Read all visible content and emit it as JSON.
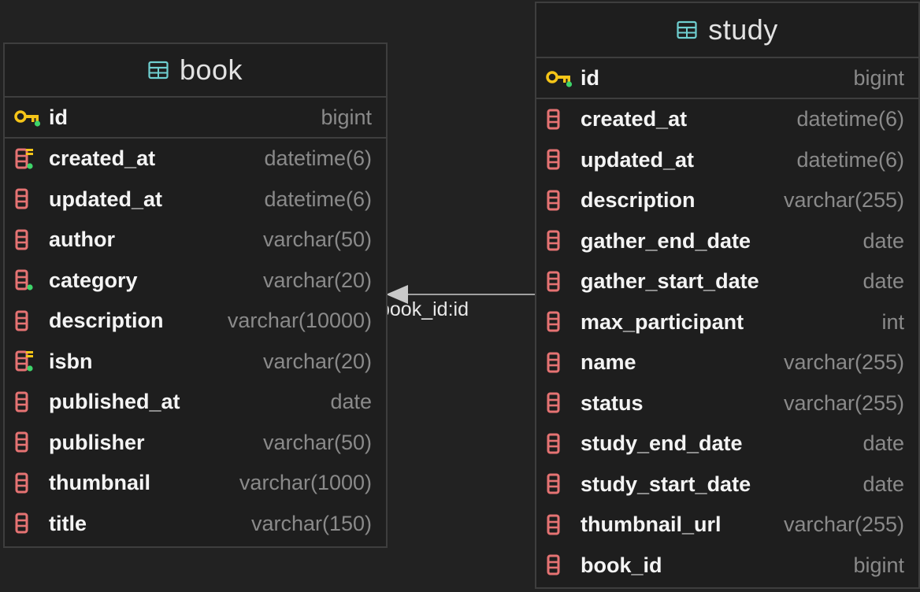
{
  "colors": {
    "background": "#222222",
    "table_border": "#3e3e3e",
    "column_icon": "#e57373",
    "key_icon": "#f5c518",
    "table_icon": "#6fcfd0",
    "indicator_green": "#3ed46a",
    "relation_line": "#a0a0a0"
  },
  "tables": {
    "book": {
      "title": "book",
      "icon": "table-icon",
      "primary_key": {
        "name": "id",
        "type": "bigint",
        "icon": "key-icon"
      },
      "columns": [
        {
          "name": "created_at",
          "type": "datetime(6)",
          "icon": "index-column-icon"
        },
        {
          "name": "updated_at",
          "type": "datetime(6)",
          "icon": "column-icon"
        },
        {
          "name": "author",
          "type": "varchar(50)",
          "icon": "column-icon"
        },
        {
          "name": "category",
          "type": "varchar(20)",
          "icon": "not-null-column-icon"
        },
        {
          "name": "description",
          "type": "varchar(10000)",
          "icon": "column-icon"
        },
        {
          "name": "isbn",
          "type": "varchar(20)",
          "icon": "index-column-icon"
        },
        {
          "name": "published_at",
          "type": "date",
          "icon": "column-icon"
        },
        {
          "name": "publisher",
          "type": "varchar(50)",
          "icon": "column-icon"
        },
        {
          "name": "thumbnail",
          "type": "varchar(1000)",
          "icon": "column-icon"
        },
        {
          "name": "title",
          "type": "varchar(150)",
          "icon": "column-icon"
        }
      ]
    },
    "study": {
      "title": "study",
      "icon": "table-icon",
      "primary_key": {
        "name": "id",
        "type": "bigint",
        "icon": "key-icon"
      },
      "columns": [
        {
          "name": "created_at",
          "type": "datetime(6)",
          "icon": "column-icon"
        },
        {
          "name": "updated_at",
          "type": "datetime(6)",
          "icon": "column-icon"
        },
        {
          "name": "description",
          "type": "varchar(255)",
          "icon": "column-icon"
        },
        {
          "name": "gather_end_date",
          "type": "date",
          "icon": "column-icon"
        },
        {
          "name": "gather_start_date",
          "type": "date",
          "icon": "column-icon"
        },
        {
          "name": "max_participant",
          "type": "int",
          "icon": "column-icon"
        },
        {
          "name": "name",
          "type": "varchar(255)",
          "icon": "column-icon"
        },
        {
          "name": "status",
          "type": "varchar(255)",
          "icon": "column-icon"
        },
        {
          "name": "study_end_date",
          "type": "date",
          "icon": "column-icon"
        },
        {
          "name": "study_start_date",
          "type": "date",
          "icon": "column-icon"
        },
        {
          "name": "thumbnail_url",
          "type": "varchar(255)",
          "icon": "column-icon"
        },
        {
          "name": "book_id",
          "type": "bigint",
          "icon": "column-icon"
        }
      ]
    }
  },
  "relation": {
    "label": "book_id:id",
    "from": "study",
    "to": "book"
  }
}
